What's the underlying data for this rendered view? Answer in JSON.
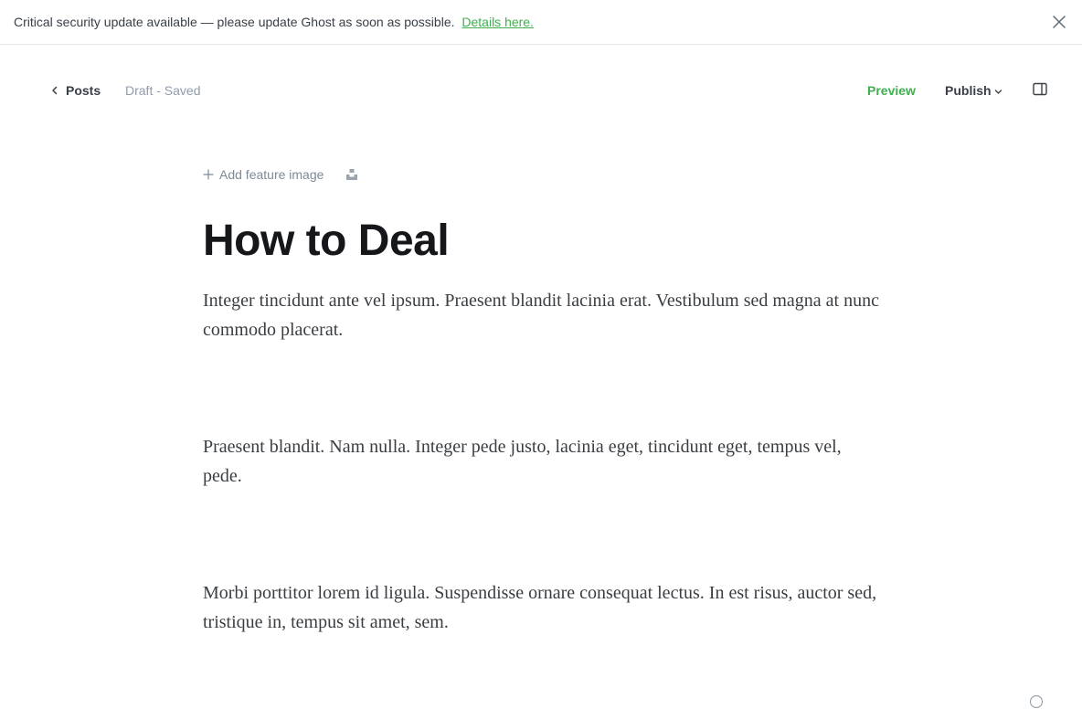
{
  "banner": {
    "message": "Critical security update available — please update Ghost as soon as possible.",
    "link_text": "Details here.",
    "close_icon": "close-icon"
  },
  "topbar": {
    "back_label": "Posts",
    "back_icon": "chevron-left-icon",
    "status": "Draft - Saved",
    "preview_label": "Preview",
    "publish_label": "Publish",
    "publish_icon": "chevron-down-icon",
    "sidebar_icon": "sidebar-toggle-icon"
  },
  "editor": {
    "add_feature_image": "Add feature image",
    "unsplash_icon": "unsplash-icon",
    "title": "How to Deal",
    "paragraphs": [
      "Integer tincidunt ante vel ipsum. Praesent blandit lacinia erat. Vestibulum sed magna at nunc commodo placerat.",
      "Praesent blandit. Nam nulla. Integer pede justo, lacinia eget, tincidunt eget, tempus vel, pede.",
      "Morbi porttitor lorem id ligula. Suspendisse ornare consequat lectus. In est risus, auctor sed, tristique in, tempus sit amet, sem."
    ]
  },
  "colors": {
    "accent": "#3eb04f",
    "text_dark": "#15171a",
    "text_muted": "#8e9cac",
    "border": "#e6e9eb"
  }
}
